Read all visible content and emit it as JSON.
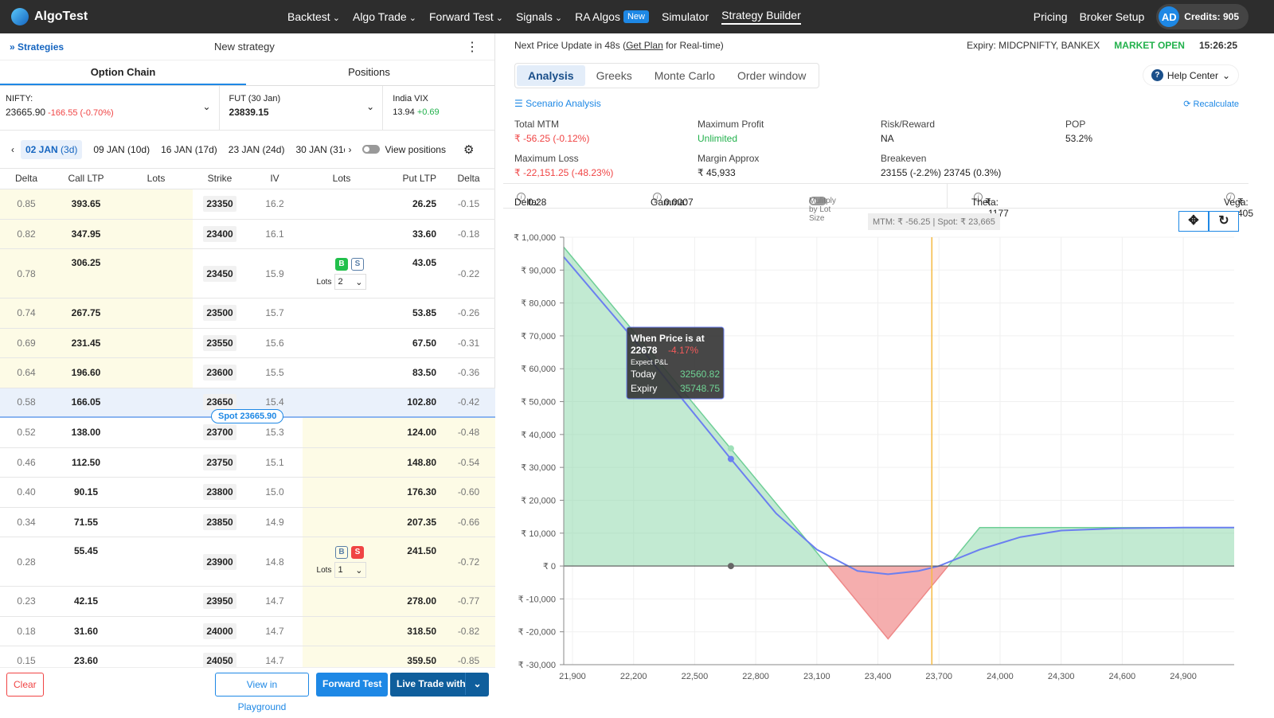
{
  "nav": {
    "brand": "AlgoTest",
    "items": [
      {
        "label": "Backtest",
        "dd": true
      },
      {
        "label": "Algo Trade",
        "dd": true
      },
      {
        "label": "Forward Test",
        "dd": true
      },
      {
        "label": "Signals",
        "dd": true
      },
      {
        "label": "RA Algos",
        "badge": "New"
      },
      {
        "label": "Simulator"
      },
      {
        "label": "Strategy Builder",
        "active": true
      }
    ],
    "pricing": "Pricing",
    "broker": "Broker Setup",
    "avatar": "AD",
    "credits": "Credits: 905"
  },
  "left": {
    "strategies": "Strategies",
    "title": "New strategy",
    "tabs": [
      "Option Chain",
      "Positions"
    ],
    "nifty": {
      "label": "NIFTY:",
      "value": "23665.90",
      "change": "-166.55 (-0.70%)"
    },
    "fut": {
      "label": "FUT (30 Jan)",
      "value": "23839.15"
    },
    "vix": {
      "label": "India VIX",
      "value": "13.94",
      "change": "+0.69"
    },
    "expiries": [
      "02 JAN",
      "(3d)",
      "09 JAN (10d)",
      "16 JAN (17d)",
      "23 JAN (24d)",
      "30 JAN (31d"
    ],
    "view_positions": "View positions",
    "headers": [
      "Delta",
      "Call LTP",
      "Lots",
      "Strike",
      "IV",
      "Lots",
      "Put LTP",
      "Delta"
    ],
    "spot_label": "Spot 23665.90",
    "lots_label": "Lots",
    "rows": [
      {
        "cd": "0.85",
        "cl": "393.65",
        "k": "23350",
        "iv": "16.2",
        "pl": "26.25",
        "pd": "-0.15"
      },
      {
        "cd": "0.82",
        "cl": "347.95",
        "k": "23400",
        "iv": "16.1",
        "pl": "33.60",
        "pd": "-0.18"
      },
      {
        "cd": "0.78",
        "cl": "306.25",
        "k": "23450",
        "iv": "15.9",
        "pl": "43.05",
        "pd": "-0.22",
        "pos": "B",
        "lots": "2"
      },
      {
        "cd": "0.74",
        "cl": "267.75",
        "k": "23500",
        "iv": "15.7",
        "pl": "53.85",
        "pd": "-0.26"
      },
      {
        "cd": "0.69",
        "cl": "231.45",
        "k": "23550",
        "iv": "15.6",
        "pl": "67.50",
        "pd": "-0.31"
      },
      {
        "cd": "0.64",
        "cl": "196.60",
        "k": "23600",
        "iv": "15.5",
        "pl": "83.50",
        "pd": "-0.36"
      },
      {
        "cd": "0.58",
        "cl": "166.05",
        "k": "23650",
        "iv": "15.4",
        "pl": "102.80",
        "pd": "-0.42",
        "atm": true
      },
      {
        "cd": "0.52",
        "cl": "138.00",
        "k": "23700",
        "iv": "15.3",
        "pl": "124.00",
        "pd": "-0.48"
      },
      {
        "cd": "0.46",
        "cl": "112.50",
        "k": "23750",
        "iv": "15.1",
        "pl": "148.80",
        "pd": "-0.54"
      },
      {
        "cd": "0.40",
        "cl": "90.15",
        "k": "23800",
        "iv": "15.0",
        "pl": "176.30",
        "pd": "-0.60"
      },
      {
        "cd": "0.34",
        "cl": "71.55",
        "k": "23850",
        "iv": "14.9",
        "pl": "207.35",
        "pd": "-0.66"
      },
      {
        "cd": "0.28",
        "cl": "55.45",
        "k": "23900",
        "iv": "14.8",
        "pl": "241.50",
        "pd": "-0.72",
        "pos": "S",
        "lots": "1"
      },
      {
        "cd": "0.23",
        "cl": "42.15",
        "k": "23950",
        "iv": "14.7",
        "pl": "278.00",
        "pd": "-0.77"
      },
      {
        "cd": "0.18",
        "cl": "31.60",
        "k": "24000",
        "iv": "14.7",
        "pl": "318.50",
        "pd": "-0.82"
      },
      {
        "cd": "0.15",
        "cl": "23.60",
        "k": "24050",
        "iv": "14.7",
        "pl": "359.50",
        "pd": "-0.85"
      }
    ],
    "buttons": {
      "clear": "Clear",
      "playground": "View in Playground",
      "forward": "Forward Test",
      "live": "Live Trade with"
    }
  },
  "right": {
    "update_pre": "Next Price Update in 48s (",
    "get_plan": "Get Plan",
    "update_post": " for Real-time)",
    "expiry": "Expiry:  MIDCPNIFTY, BANKEX",
    "market": "MARKET OPEN",
    "time": "15:26:25",
    "tabs": [
      "Analysis",
      "Greeks",
      "Monte Carlo",
      "Order window"
    ],
    "help": "Help Center",
    "scenario": "Scenario Analysis",
    "recalc": "Recalculate",
    "stats": [
      {
        "l": "Total MTM",
        "v": "₹ -56.25 (-0.12%)",
        "c": "red"
      },
      {
        "l": "Maximum Profit",
        "v": "Unlimited",
        "c": "grn"
      },
      {
        "l": "Risk/Reward",
        "v": "NA"
      },
      {
        "l": "POP",
        "v": "53.2%"
      },
      {
        "l": "Maximum Loss",
        "v": "₹ -22,151.25 (-48.23%)",
        "c": "red"
      },
      {
        "l": "Margin Approx",
        "v": "₹ 45,933"
      },
      {
        "l": "Breakeven",
        "v": "23155 (-2.2%)  23745 (0.3%)"
      }
    ],
    "greeks": {
      "delta_l": "Delta:",
      "delta": "0.28",
      "gamma_l": "Gamma:",
      "gamma": "0.0007",
      "mult": "Mulitply by Lot Size",
      "theta_l": "Theta:",
      "theta": "₹ -1177",
      "vega_l": "Vega:",
      "vega": "₹ 405"
    },
    "mtm_box": "MTM: ₹ -56.25  |  Spot: ₹ 23,665"
  },
  "chart_data": {
    "type": "area",
    "xlim": [
      21857,
      25150
    ],
    "ylim": [
      -30000,
      100000
    ],
    "x_ticks": [
      21900,
      22200,
      22500,
      22800,
      23100,
      23400,
      23700,
      24000,
      24300,
      24600,
      24900
    ],
    "x_tick_labels": [
      "21,900",
      "22,200",
      "22,500",
      "22,800",
      "23,100",
      "23,400",
      "23,700",
      "24,000",
      "24,300",
      "24,600",
      "24,900"
    ],
    "y_ticks": [
      100000,
      90000,
      80000,
      70000,
      60000,
      50000,
      40000,
      30000,
      20000,
      10000,
      0,
      -10000,
      -20000,
      -30000
    ],
    "y_tick_labels": [
      "₹ 1,00,000",
      "₹ 90,000",
      "₹ 80,000",
      "₹ 70,000",
      "₹ 60,000",
      "₹ 50,000",
      "₹ 40,000",
      "₹ 30,000",
      "₹ 20,000",
      "₹ 10,000",
      "₹ 0",
      "₹ -10,000",
      "₹ -20,000",
      "₹ -30,000"
    ],
    "grid": true,
    "spot": 23665,
    "expiry_series": {
      "x": [
        21857,
        23155,
        23450,
        23745,
        23900,
        25150
      ],
      "y": [
        97000,
        0,
        -22151,
        0,
        11700,
        11700
      ]
    },
    "today_series": {
      "x": [
        21857,
        22200,
        22678,
        22900,
        23100,
        23300,
        23450,
        23600,
        23700,
        23900,
        24100,
        24300,
        24600,
        24900,
        25150
      ],
      "y": [
        94000,
        69000,
        32560,
        16000,
        5000,
        -1500,
        -2500,
        -1500,
        0,
        5000,
        8800,
        10800,
        11500,
        11700,
        11700
      ]
    },
    "colors": {
      "profit": "#8fd9ad",
      "loss": "#f39a9a",
      "today": "#6b7ff0",
      "expiry": "#6fcf97",
      "spot": "#f5b942"
    },
    "tooltip": {
      "title": "When Price is at",
      "price": "22678",
      "pct": "-4.17%",
      "sub": "Expect P&L",
      "today_l": "Today",
      "today": "32560.82",
      "expiry_l": "Expiry",
      "expiry": "35748.75",
      "x": 22678
    }
  }
}
